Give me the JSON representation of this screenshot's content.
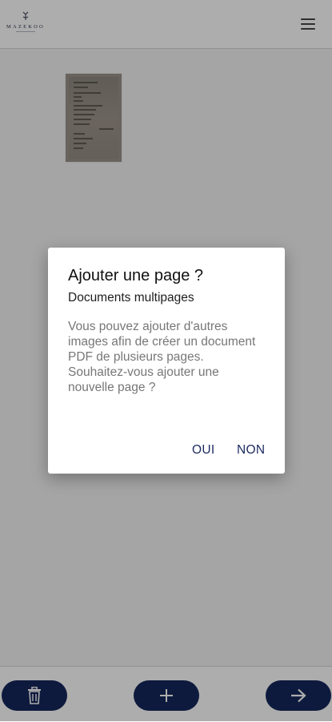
{
  "header": {
    "logo_text": "MAZEKOO",
    "menu_icon": "hamburger-menu-icon"
  },
  "content": {
    "thumbnail_icon": "document-thumbnail"
  },
  "footer": {
    "delete_icon": "trash-icon",
    "add_icon": "plus-icon",
    "next_icon": "arrow-right-icon",
    "button_color": "#16275a"
  },
  "dialog": {
    "title": "Ajouter une page ?",
    "subtitle": "Documents multipages",
    "message": "Vous pouvez ajouter d'autres images afin de créer un document PDF de plusieurs pages.\nSouhaitez-vous ajouter une nouvelle page ?",
    "yes_label": "OUI",
    "no_label": "NON",
    "action_color": "#1b2a5f"
  }
}
